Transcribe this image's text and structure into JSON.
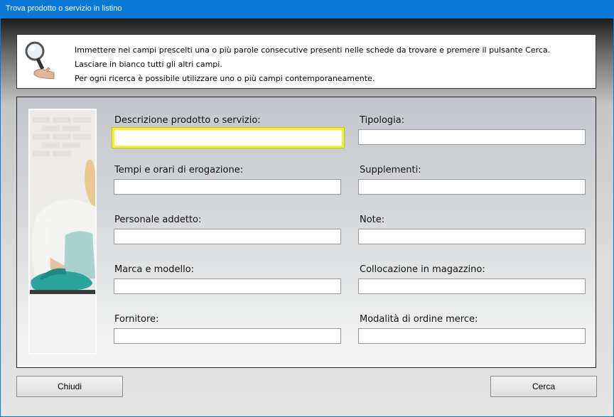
{
  "window": {
    "title": "Trova prodotto o servizio in listino"
  },
  "info": {
    "lines": [
      "Immettere nei campi prescelti una o più parole consecutive presenti nelle schede da trovare e premere il pulsante Cerca.",
      "Lasciare in bianco tutti gli altri campi.",
      "Per ogni ricerca è possibile utilizzare uno o più campi contemporaneamente."
    ]
  },
  "fields": {
    "descrizione": {
      "label": "Descrizione prodotto o servizio:",
      "value": ""
    },
    "tipologia": {
      "label": "Tipologia:",
      "value": ""
    },
    "tempi": {
      "label": "Tempi e orari di erogazione:",
      "value": ""
    },
    "supplementi": {
      "label": "Supplementi:",
      "value": ""
    },
    "personale": {
      "label": "Personale addetto:",
      "value": ""
    },
    "note": {
      "label": "Note:",
      "value": ""
    },
    "marca": {
      "label": "Marca e modello:",
      "value": ""
    },
    "collocazione": {
      "label": "Collocazione in magazzino:",
      "value": ""
    },
    "fornitore": {
      "label": "Fornitore:",
      "value": ""
    },
    "modalita": {
      "label": "Modalità di ordine merce:",
      "value": ""
    }
  },
  "buttons": {
    "close_label": "Chiudi",
    "search_label": "Cerca"
  },
  "colors": {
    "titlebar": "#0a78d7",
    "focus_border": "#f4f22c"
  },
  "icons": {
    "info": "magnifier-hand-icon"
  }
}
